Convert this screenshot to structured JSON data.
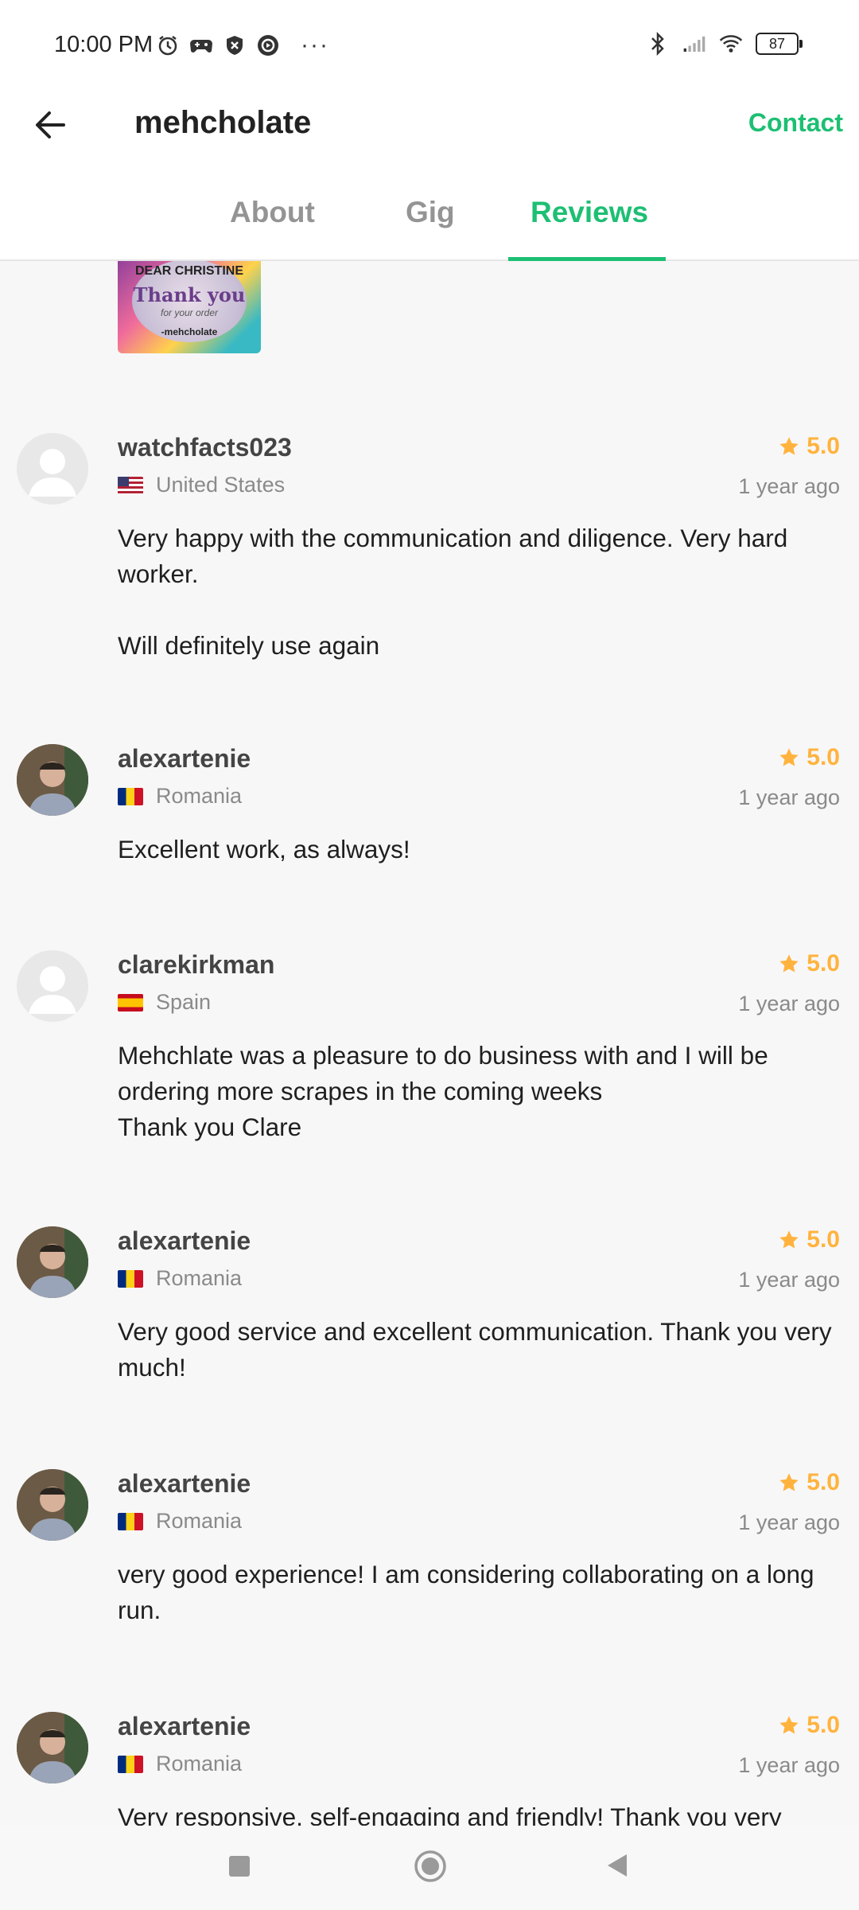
{
  "status_bar": {
    "time": "10:00 PM",
    "battery": "87",
    "icons": [
      "alarm-icon",
      "game-controller-icon",
      "shield-icon",
      "media-icon",
      "bluetooth-icon",
      "signal-icon",
      "wifi-icon",
      "battery-icon"
    ],
    "more": "···"
  },
  "header": {
    "title": "mehcholate",
    "contact_label": "Contact"
  },
  "tabs": [
    {
      "label": "About",
      "active": false
    },
    {
      "label": "Gig",
      "active": false
    },
    {
      "label": "Reviews",
      "active": true
    }
  ],
  "thumbnail": {
    "line1": "DEAR CHRISTINE",
    "line2": "Thank you",
    "line3": "for your order",
    "line4": "-mehcholate"
  },
  "reviews": [
    {
      "username": "watchfacts023",
      "country": "United States",
      "rating": "5.0",
      "time": "1 year ago",
      "text": "Very happy with the communication and diligence. Very hard worker.\n\nWill definitely use again",
      "avatar": "placeholder"
    },
    {
      "username": "alexartenie",
      "country": "Romania",
      "rating": "5.0",
      "time": "1 year ago",
      "text": "Excellent work, as always!",
      "avatar": "photo"
    },
    {
      "username": "clarekirkman",
      "country": "Spain",
      "rating": "5.0",
      "time": "1 year ago",
      "text": "Mehchlate was a pleasure to do business with and I will be ordering more scrapes in the coming weeks\nThank you Clare",
      "avatar": "placeholder"
    },
    {
      "username": "alexartenie",
      "country": "Romania",
      "rating": "5.0",
      "time": "1 year ago",
      "text": "Very good service and excellent communication. Thank you very much!",
      "avatar": "photo"
    },
    {
      "username": "alexartenie",
      "country": "Romania",
      "rating": "5.0",
      "time": "1 year ago",
      "text": "very good experience! I am considering collaborating on a long run.",
      "avatar": "photo"
    },
    {
      "username": "alexartenie",
      "country": "Romania",
      "rating": "5.0",
      "time": "1 year ago",
      "text": "Very responsive, self-engaging and friendly! Thank you very",
      "avatar": "photo"
    }
  ],
  "colors": {
    "accent": "#1dbf73",
    "star": "#ffb33e"
  },
  "nav": [
    "recents-button",
    "home-button",
    "back-button"
  ]
}
